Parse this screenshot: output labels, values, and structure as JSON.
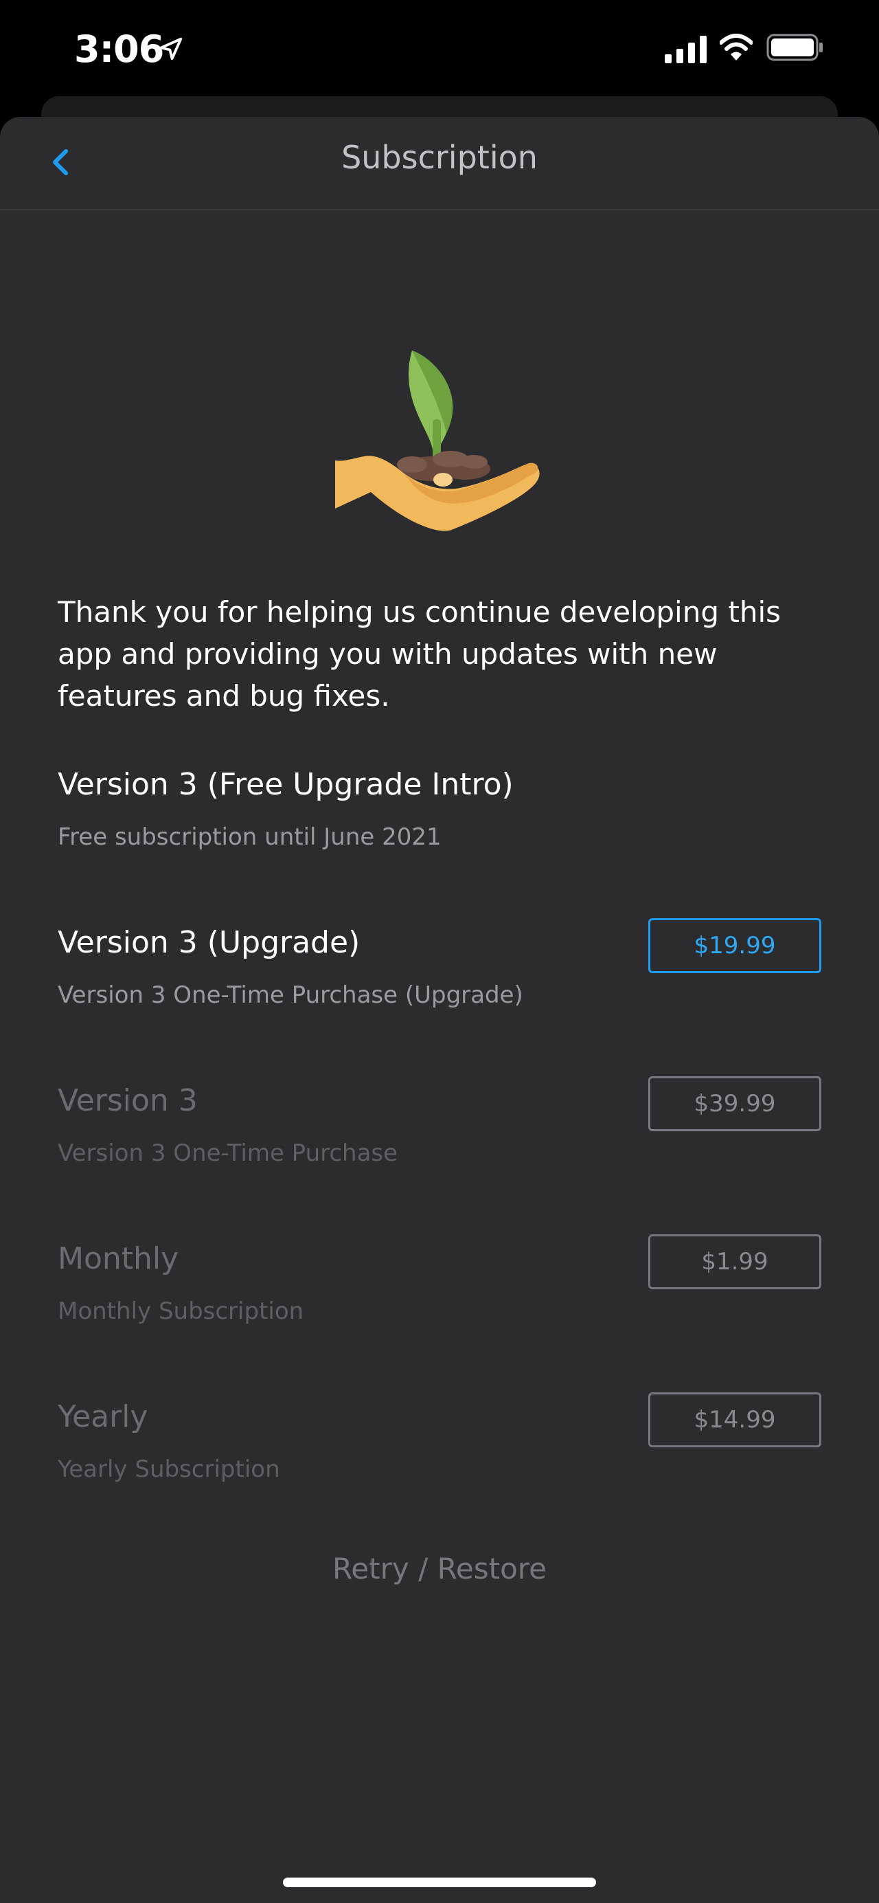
{
  "status_bar": {
    "time": "3:06",
    "icons": [
      "location-arrow-icon",
      "signal-icon",
      "wifi-icon",
      "battery-icon"
    ]
  },
  "nav": {
    "title": "Subscription",
    "back_icon": "chevron-left-icon"
  },
  "illustration": {
    "icon": "hand-holding-sprout-icon"
  },
  "intro": {
    "text": "Thank you for helping us continue developing this app and providing you with updates with new features and bug fixes."
  },
  "plans": [
    {
      "title": "Version 3 (Free Upgrade Intro)",
      "subtitle": "Free subscription until June 2021"
    },
    {
      "title": "Version 3 (Upgrade)",
      "subtitle": "Version 3 One-Time Purchase (Upgrade)",
      "price": "$19.99"
    },
    {
      "title": "Version 3",
      "subtitle": "Version 3 One-Time Purchase",
      "price": "$39.99"
    },
    {
      "title": "Monthly",
      "subtitle": "Monthly Subscription",
      "price": "$1.99"
    },
    {
      "title": "Yearly",
      "subtitle": "Yearly Subscription",
      "price": "$14.99"
    }
  ],
  "restore": {
    "label": "Retry / Restore"
  },
  "colors": {
    "background": "#2c2c2e",
    "accent": "#2fa8f5",
    "text_primary": "#ffffff",
    "text_secondary": "#9a9a9f",
    "text_disabled": "#6b6b70"
  }
}
